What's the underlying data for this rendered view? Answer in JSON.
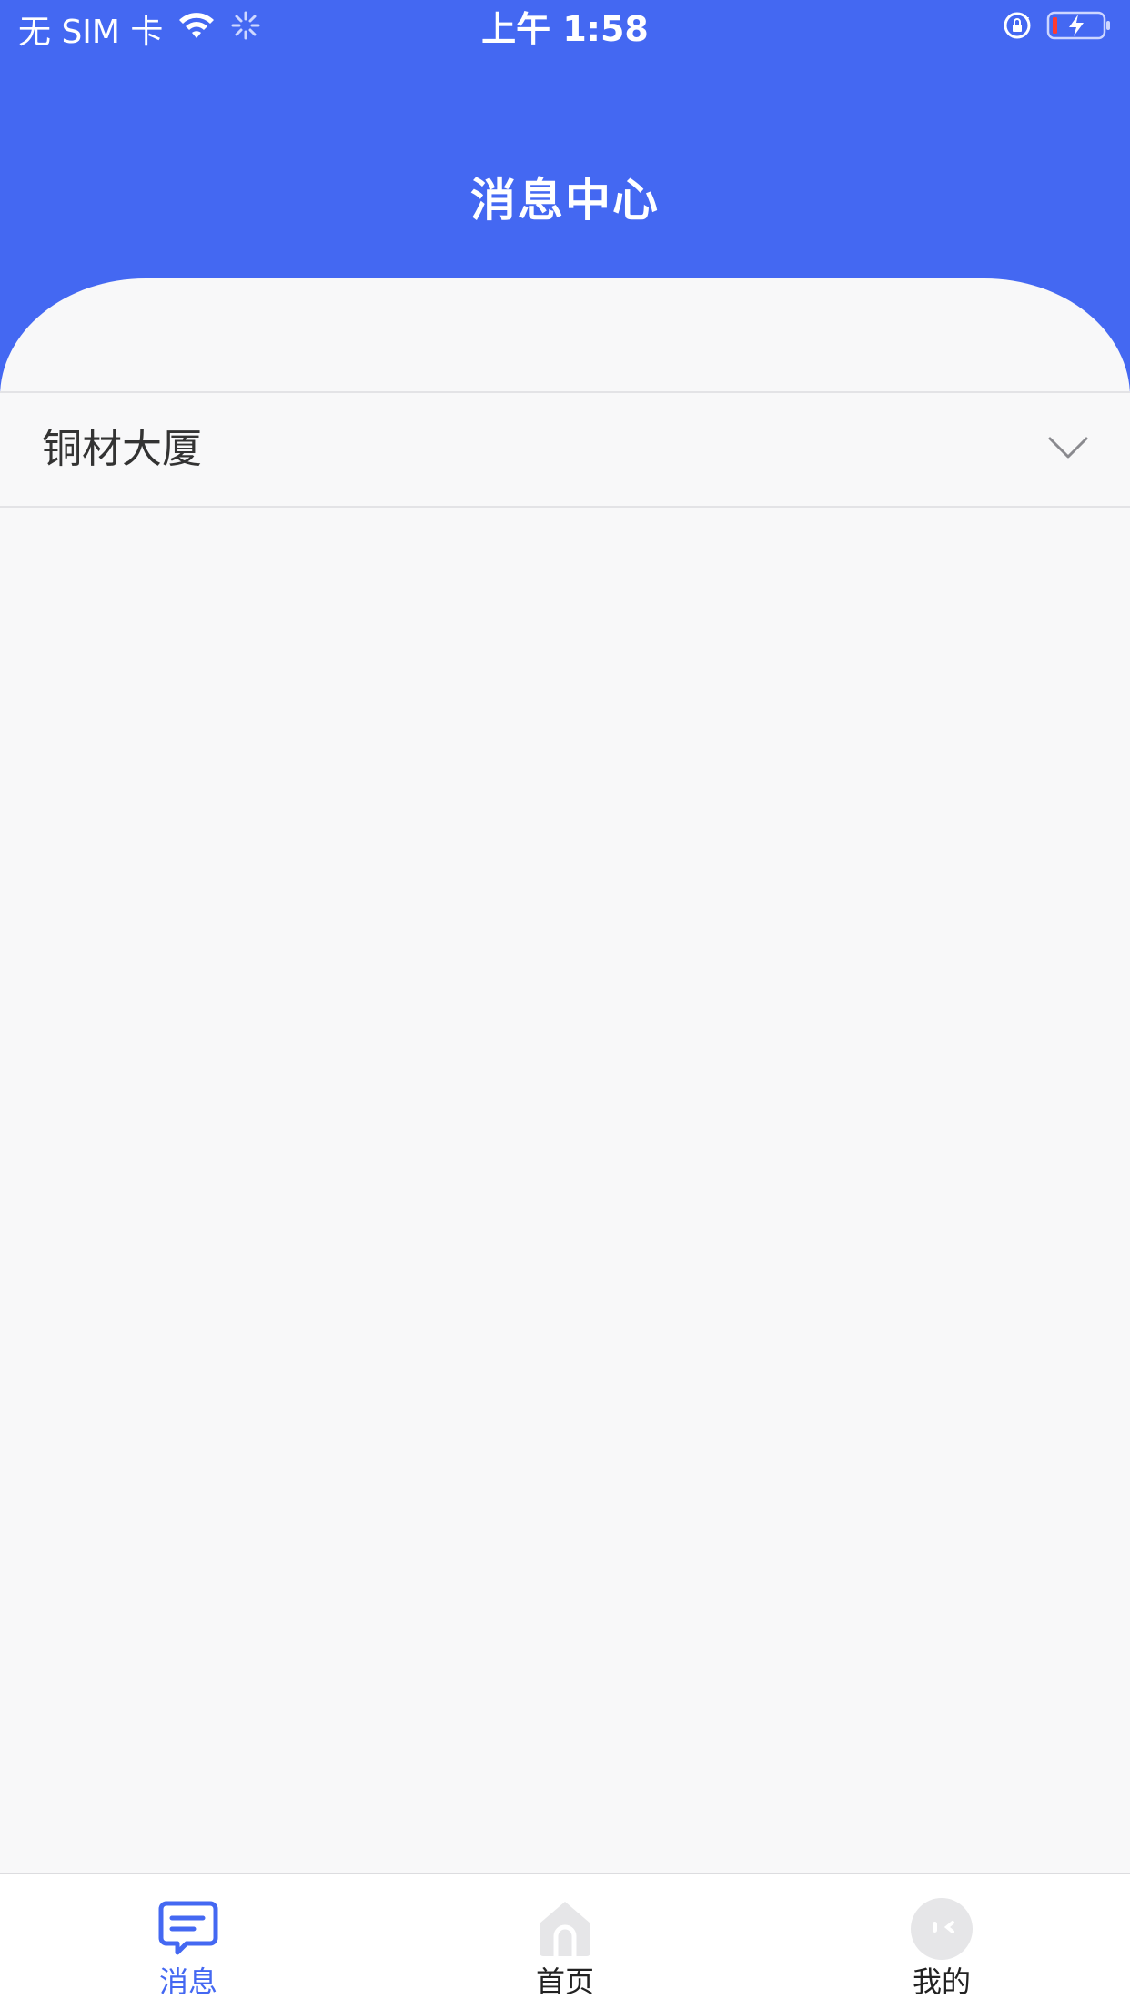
{
  "status_bar": {
    "carrier": "无 SIM 卡",
    "time": "上午 1:58"
  },
  "header": {
    "title": "消息中心"
  },
  "selector": {
    "value": "铜材大厦"
  },
  "tabs": [
    {
      "label": "消息",
      "icon": "message-icon",
      "active": true
    },
    {
      "label": "首页",
      "icon": "home-icon",
      "active": false
    },
    {
      "label": "我的",
      "icon": "profile-icon",
      "active": false
    }
  ],
  "colors": {
    "primary": "#4468f2",
    "background": "#f8f8f9",
    "icon_inactive": "#e6e6e8"
  }
}
